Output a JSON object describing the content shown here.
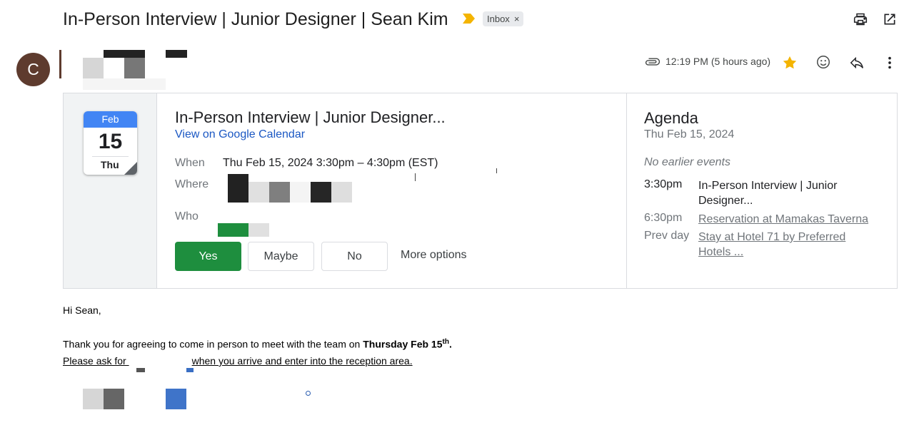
{
  "header": {
    "subject": "In-Person Interview | Junior Designer | Sean Kim",
    "label": "Inbox",
    "label_remove": "×",
    "icons": {
      "print": "printer-icon",
      "popout": "open-in-new-icon"
    }
  },
  "sender": {
    "avatar_letter": "C",
    "time": "12:19 PM (5 hours ago)",
    "icons": [
      "attachment-icon",
      "star-icon",
      "emoji-icon",
      "reply-icon",
      "more-vert-icon"
    ]
  },
  "invite": {
    "cal_month": "Feb",
    "cal_day": "15",
    "cal_weekday": "Thu",
    "title": "In-Person Interview | Junior Designer...",
    "link": "View on Google Calendar",
    "when_label": "When",
    "when_value": "Thu Feb 15, 2024 3:30pm – 4:30pm (EST)",
    "where_label": "Where",
    "who_label": "Who",
    "buttons": {
      "yes": "Yes",
      "maybe": "Maybe",
      "no": "No",
      "more": "More options"
    }
  },
  "agenda": {
    "title": "Agenda",
    "date": "Thu Feb 15, 2024",
    "none_text": "No earlier events",
    "items": [
      {
        "time": "3:30pm",
        "event": "In-Person Interview | Junior Designer..."
      },
      {
        "time": "6:30pm",
        "event": "Reservation at Mamakas Taverna"
      },
      {
        "time": "Prev day",
        "event": "Stay at Hotel 71 by Preferred Hotels ..."
      }
    ]
  },
  "message": {
    "greeting": "Hi Sean,",
    "line1_a": "Thank you for agreeing to come in person to meet with the team on ",
    "line1_bold": "Thursday Feb 15",
    "line1_sup": "th",
    "line1_end": ".",
    "line2_a": "Please ask for ",
    "line2_b": "when you arrive and enter into the reception area."
  },
  "colors": {
    "accent_blue": "#1a57c3",
    "yes_green": "#1e8e3e",
    "avatar_brown": "#5e3b2e",
    "star_yellow": "#f4b400",
    "marker_yellow": "#f4b400",
    "calendar_blue": "#4285f4"
  }
}
